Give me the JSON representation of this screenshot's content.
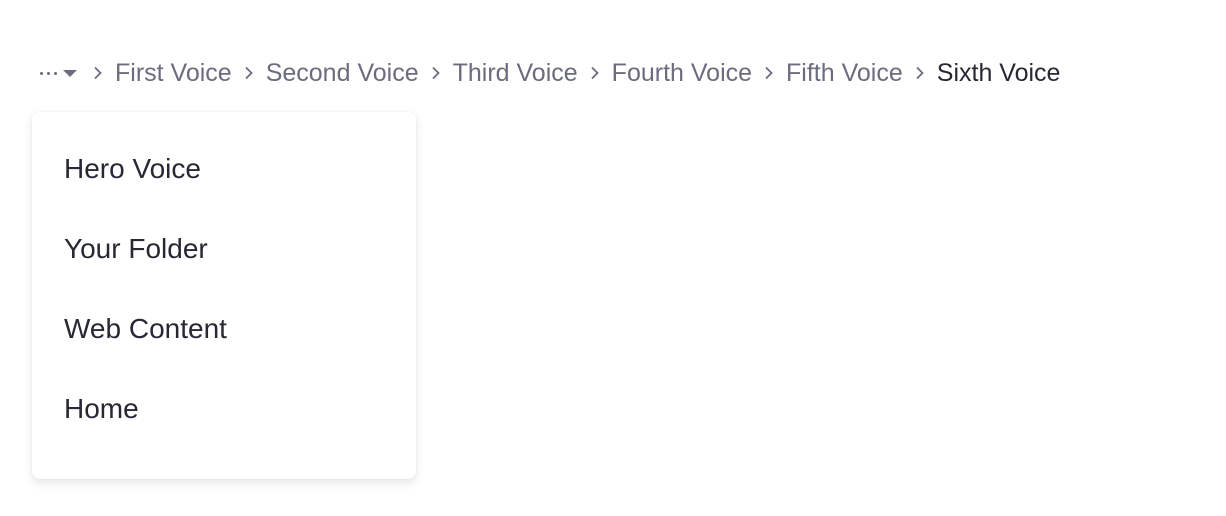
{
  "breadcrumb": {
    "overflow_icon": "ellipsis-icon",
    "caret_icon": "caret-down-icon",
    "separator_icon": "chevron-right-icon",
    "items": [
      {
        "label": "First Voice"
      },
      {
        "label": "Second Voice"
      },
      {
        "label": "Third Voice"
      },
      {
        "label": "Fourth Voice"
      },
      {
        "label": "Fifth Voice"
      },
      {
        "label": "Sixth Voice"
      }
    ]
  },
  "dropdown": {
    "items": [
      {
        "label": "Hero Voice"
      },
      {
        "label": "Your Folder"
      },
      {
        "label": "Web Content"
      },
      {
        "label": "Home"
      }
    ]
  },
  "colors": {
    "link": "#6b6c7e",
    "active": "#272833",
    "background": "#ffffff"
  }
}
